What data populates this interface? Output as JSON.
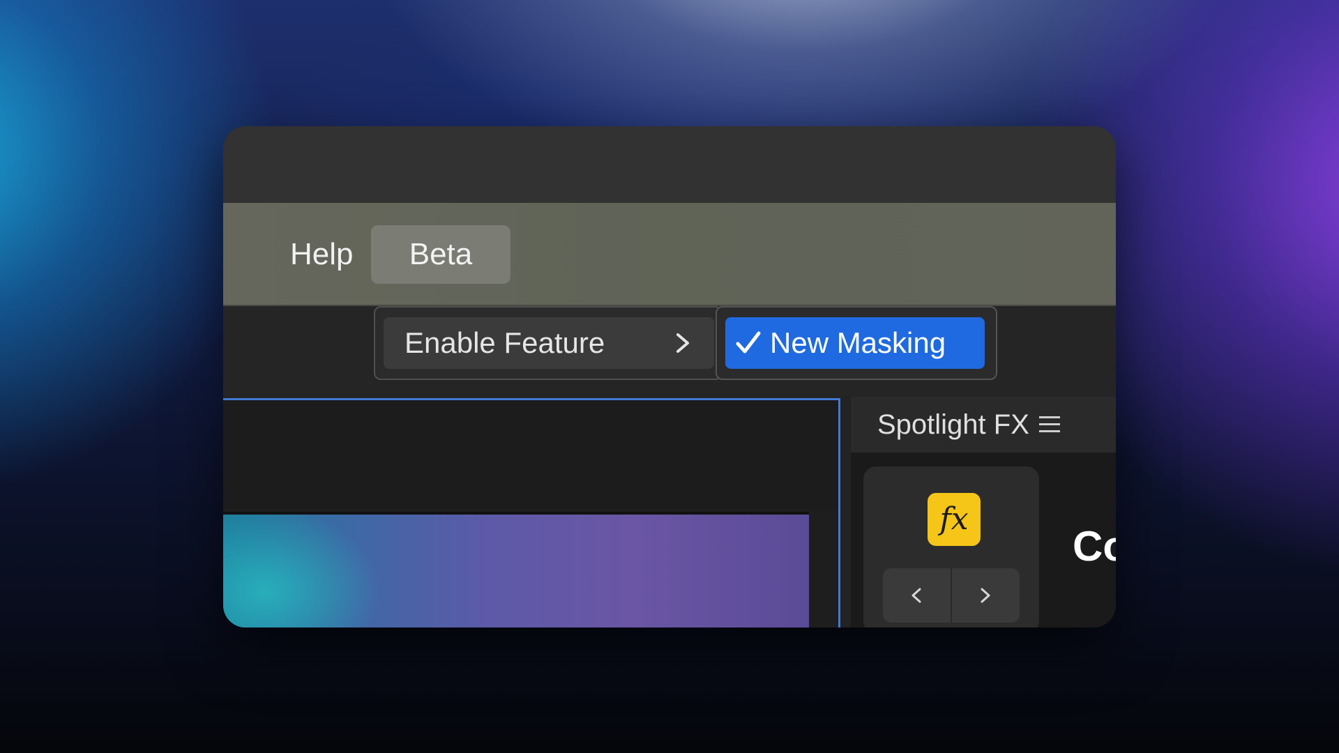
{
  "menubar": {
    "items": [
      {
        "label": "Help"
      },
      {
        "label": "Beta"
      }
    ]
  },
  "beta_menu": {
    "submenu_label": "Enable Feature",
    "submenu_icon": "chevron-right-icon",
    "flyout": {
      "label": "New Masking",
      "checked": true,
      "check_icon": "checkmark-icon"
    }
  },
  "panel": {
    "title": "Spotlight FX",
    "menu_icon": "hamburger-menu-icon",
    "fx_icon_label": "fx",
    "nav_prev_icon": "chevron-left-icon",
    "nav_next_icon": "chevron-right-icon",
    "truncated_text": "Co"
  },
  "colors": {
    "selection_blue": "#1f6ae0",
    "fx_yellow": "#f5c518",
    "active_border": "#3f7ad6"
  }
}
